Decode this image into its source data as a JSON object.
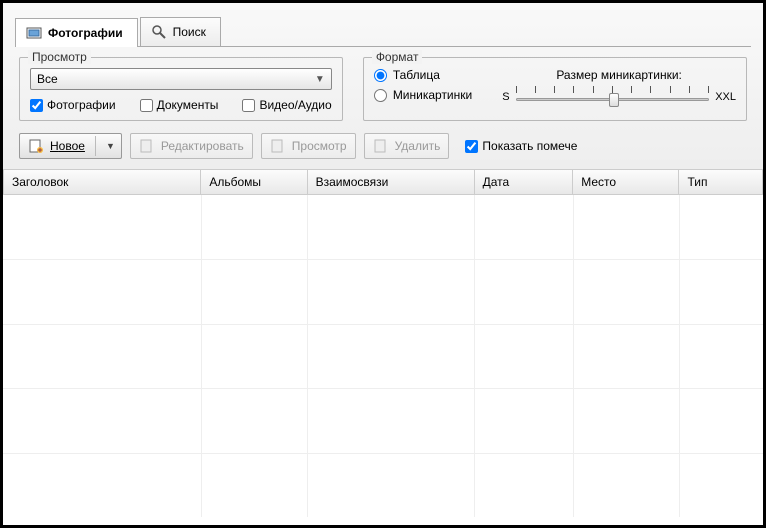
{
  "tabs": {
    "photos": "Фотографии",
    "search": "Поиск"
  },
  "view": {
    "legend": "Просмотр",
    "select_value": "Все",
    "chk_photos": "Фотографии",
    "chk_docs": "Документы",
    "chk_media": "Видео/Аудио"
  },
  "format": {
    "legend": "Формат",
    "radio_table": "Таблица",
    "radio_thumbs": "Миникартинки",
    "thumbsize_label": "Размер миникартинки:",
    "slider_min": "S",
    "slider_max": "XXL"
  },
  "toolbar": {
    "new": "Новое",
    "edit": "Редактировать",
    "view": "Просмотр",
    "delete": "Удалить",
    "show_tagged": "Показать помече"
  },
  "columns": {
    "c1": "Заголовок",
    "c2": "Альбомы",
    "c3": "Взаимосвязи",
    "c4": "Дата",
    "c5": "Место",
    "c6": "Тип"
  }
}
